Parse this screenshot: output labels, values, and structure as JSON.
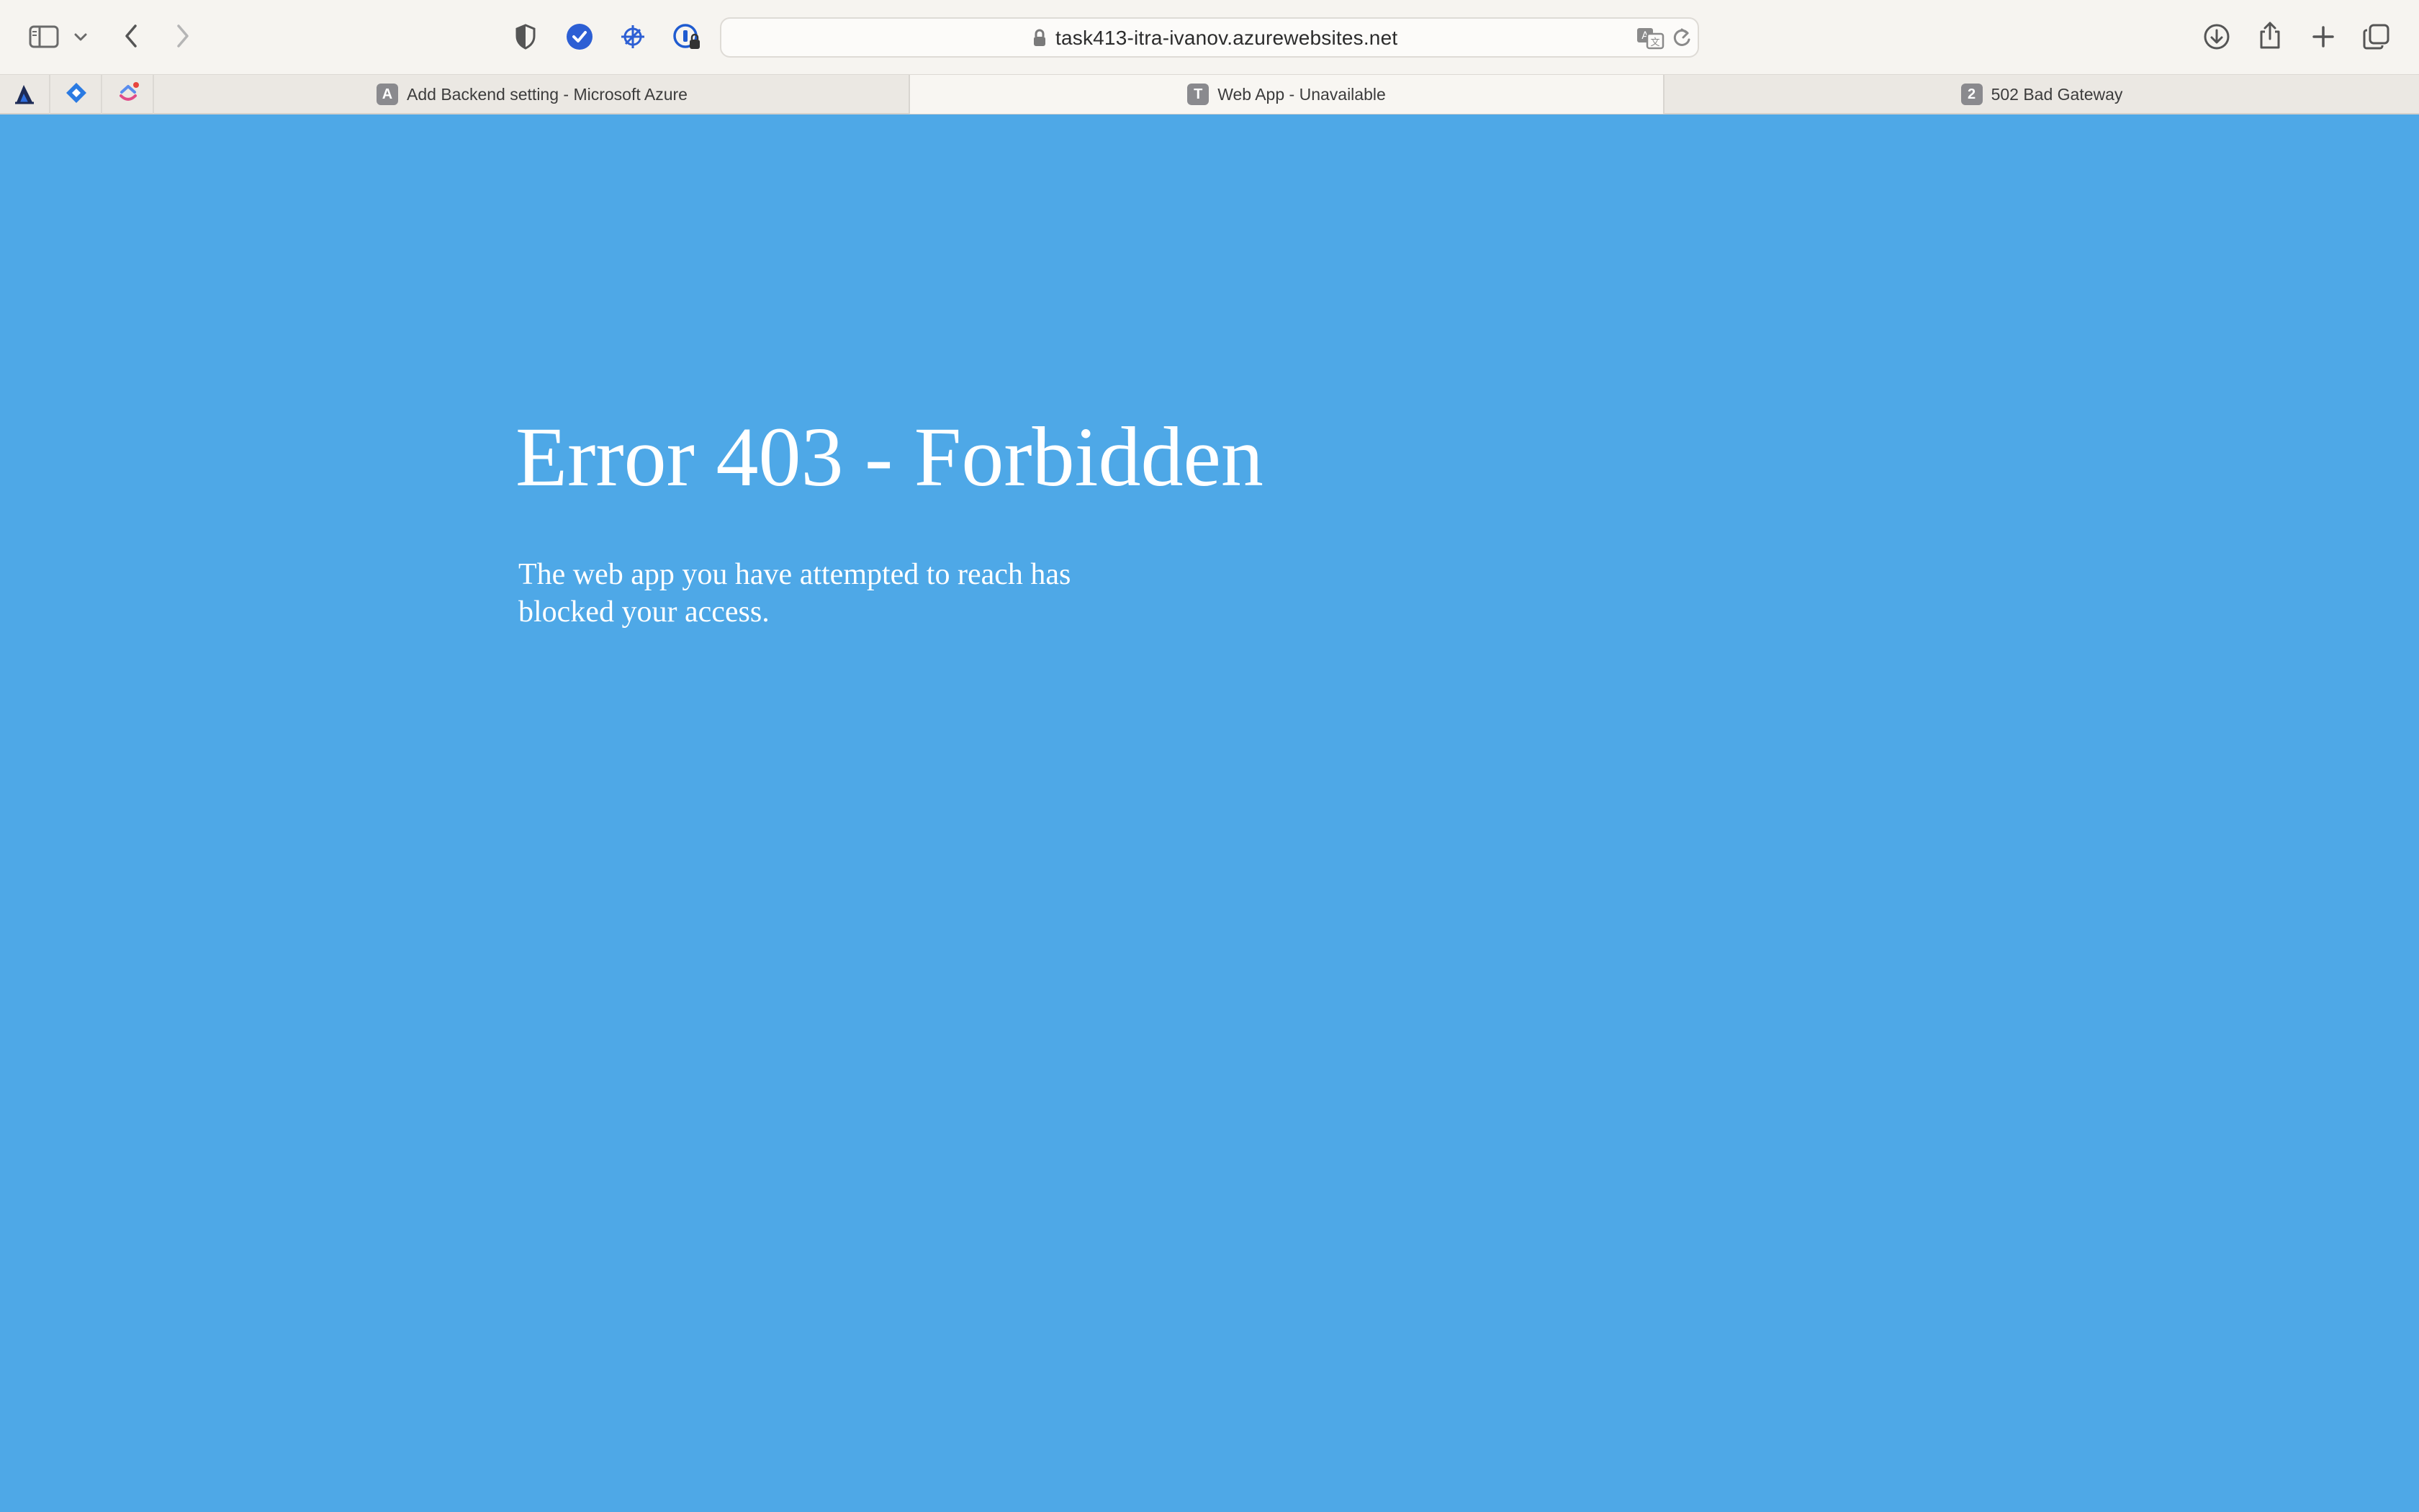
{
  "browser": {
    "url": "task413-itra-ivanov.azurewebsites.net",
    "tabs": [
      {
        "badge": "A",
        "title": "Add Backend setting - Microsoft Azure",
        "active": false
      },
      {
        "badge": "T",
        "title": "Web App - Unavailable",
        "active": true
      },
      {
        "badge": "2",
        "title": "502 Bad Gateway",
        "active": false
      }
    ],
    "pinned_tabs": [
      "atlassian-icon",
      "jira-icon",
      "clickup-icon"
    ],
    "toolbar_icons": [
      "sidebar-icon",
      "chevron-down-icon",
      "back-icon",
      "forward-icon",
      "privacy-shield-icon",
      "checkmark-extension-icon",
      "satellite-extension-icon",
      "password-extension-icon",
      "lock-icon",
      "translate-icon",
      "reload-icon",
      "download-icon",
      "share-icon",
      "new-tab-icon",
      "tab-overview-icon"
    ]
  },
  "page": {
    "background": "#4ea8e7",
    "title": "Error 403 - Forbidden",
    "message": "The web app you have attempted to reach has blocked your access."
  },
  "colors": {
    "toolbar": "#f6f4f0",
    "tabbar": "#ebe8e3",
    "active_tab": "#f8f6f2",
    "page_background": "#4ea8e7",
    "extension_blue": "#2d5fd4"
  }
}
